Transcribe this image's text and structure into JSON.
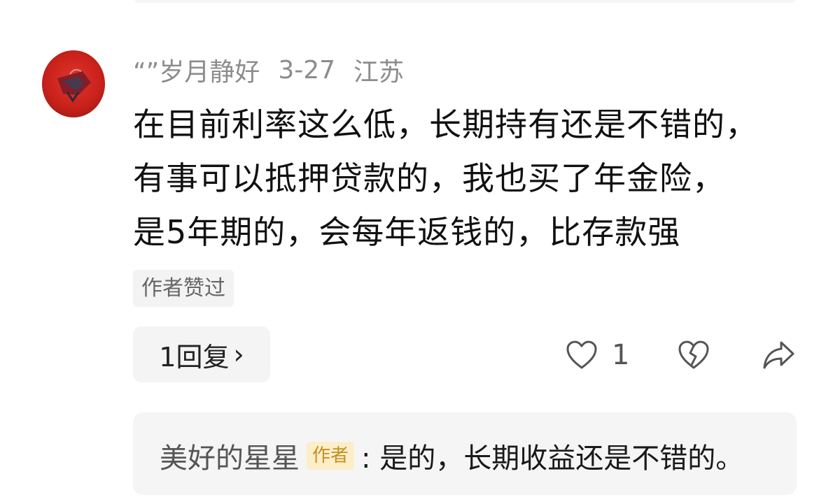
{
  "comment": {
    "username": "“”岁月静好",
    "date": "3-27",
    "location": "江苏",
    "text_lines": [
      "在目前利率这么低，长期持有还是不错的，",
      "有事可以抵押贷款的，我也买了年金险，",
      "是5年期的，会每年返钱的，比存款强"
    ],
    "author_liked": "作者赞过",
    "reply_button": "1回复",
    "reply_chevron": "›",
    "like_count": "1",
    "icons": {
      "like": "heart-icon",
      "dislike": "broken-heart-icon",
      "share": "share-arrow-icon"
    }
  },
  "reply_preview": {
    "user": "美好的星星",
    "badge": "作者",
    "text": ": 是的，长期收益还是不错的。"
  },
  "colors": {
    "avatar": "#c9221b",
    "meta_gray": "#8c8c8c",
    "badge_bg": "#fbeec9",
    "badge_text": "#c49024"
  }
}
